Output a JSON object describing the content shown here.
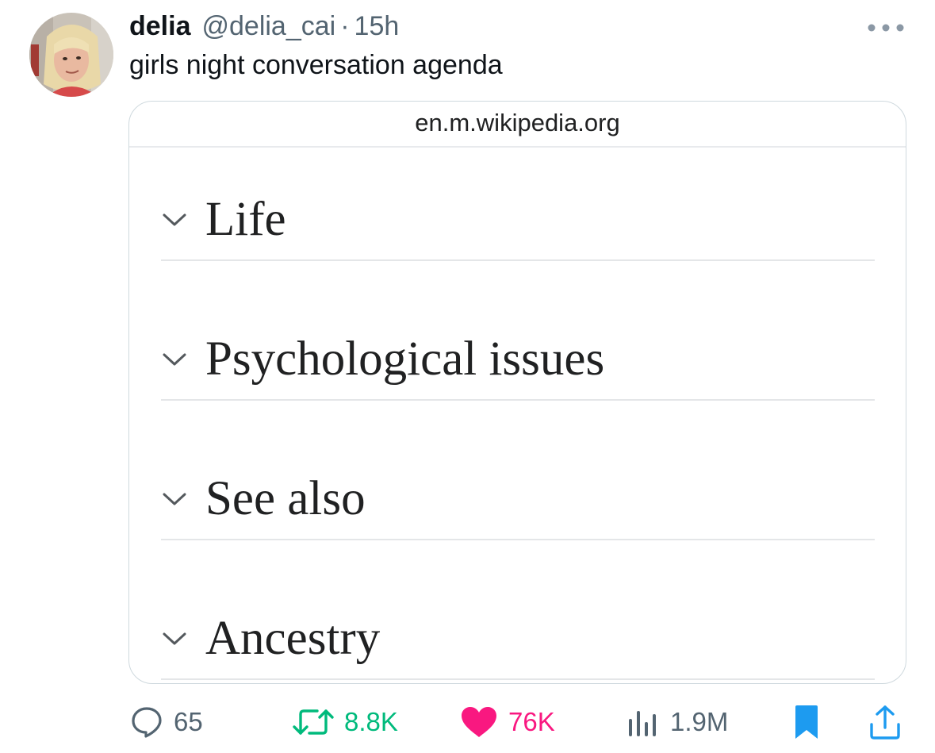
{
  "tweet": {
    "display_name": "delia",
    "handle": "@delia_cai",
    "separator": "·",
    "time": "15h",
    "text": "girls night conversation agenda",
    "more_icon": "more-horizontal-icon"
  },
  "card": {
    "domain": "en.m.wikipedia.org",
    "sections": [
      {
        "label": "Life",
        "icon": "chevron-down-icon"
      },
      {
        "label": "Psychological issues",
        "icon": "chevron-down-icon"
      },
      {
        "label": "See also",
        "icon": "chevron-down-icon"
      },
      {
        "label": "Ancestry",
        "icon": "chevron-down-icon"
      }
    ]
  },
  "actions": {
    "reply": {
      "icon": "reply-icon",
      "count": "65",
      "color": "#536471"
    },
    "retweet": {
      "icon": "retweet-icon",
      "count": "8.8K",
      "color": "#00ba7c"
    },
    "like": {
      "icon": "heart-icon",
      "count": "76K",
      "color": "#f91880",
      "active": true
    },
    "views": {
      "icon": "views-icon",
      "count": "1.9M",
      "color": "#536471"
    },
    "bookmark": {
      "icon": "bookmark-icon",
      "color": "#1d9bf0",
      "active": true
    },
    "share": {
      "icon": "share-icon",
      "color": "#1d9bf0"
    }
  },
  "colors": {
    "text_primary": "#0f1419",
    "text_secondary": "#536471",
    "card_border": "#cfd9de",
    "wiki_text": "#202122"
  }
}
